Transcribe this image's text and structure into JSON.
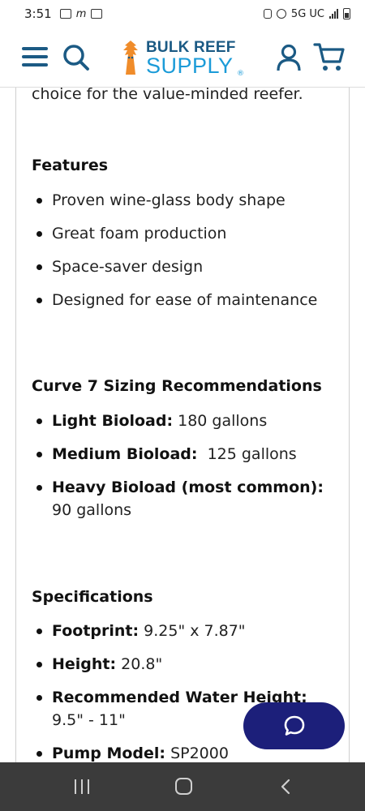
{
  "status_bar": {
    "time": "3:51",
    "notification_m": "m",
    "network": "5G UC"
  },
  "header": {
    "logo_line1": "BULK REEF",
    "logo_line2": "SUPPLY",
    "logo_mark": "®",
    "icons": [
      "menu-icon",
      "search-icon",
      "user-icon",
      "cart-icon"
    ],
    "brand_color": "#1b5a84",
    "accent_color": "#1b9bd8"
  },
  "content": {
    "intro_cut": "choice for the value-minded reefer.",
    "features": {
      "heading": "Features",
      "items": [
        "Proven wine-glass body shape",
        "Great foam production",
        "Space-saver design",
        "Designed for ease of maintenance"
      ]
    },
    "sizing": {
      "heading": "Curve 7 Sizing Recommendations",
      "items": [
        {
          "label": "Light Bioload:",
          "value": " 180 gallons"
        },
        {
          "label": "Medium Bioload:",
          "value": "  125 gallons"
        },
        {
          "label": "Heavy Bioload (most common):",
          "value": " 90 gallons"
        }
      ]
    },
    "specifications": {
      "heading": "Specifications",
      "items": [
        {
          "label": "Footprint:",
          "value": " 9.25\" x 7.87\""
        },
        {
          "label": "Height:",
          "value": " 20.8\""
        },
        {
          "label": "Recommended Water Height:",
          "value": " 9.5\" - 11\""
        },
        {
          "label": "Pump Model:",
          "value": " SP2000"
        }
      ]
    }
  },
  "chat_button": {
    "icon": "chat-bubble-icon",
    "color": "#1c1f7a"
  },
  "nav_bar": {
    "icons": [
      "recent-apps-icon",
      "home-icon",
      "back-icon"
    ]
  }
}
